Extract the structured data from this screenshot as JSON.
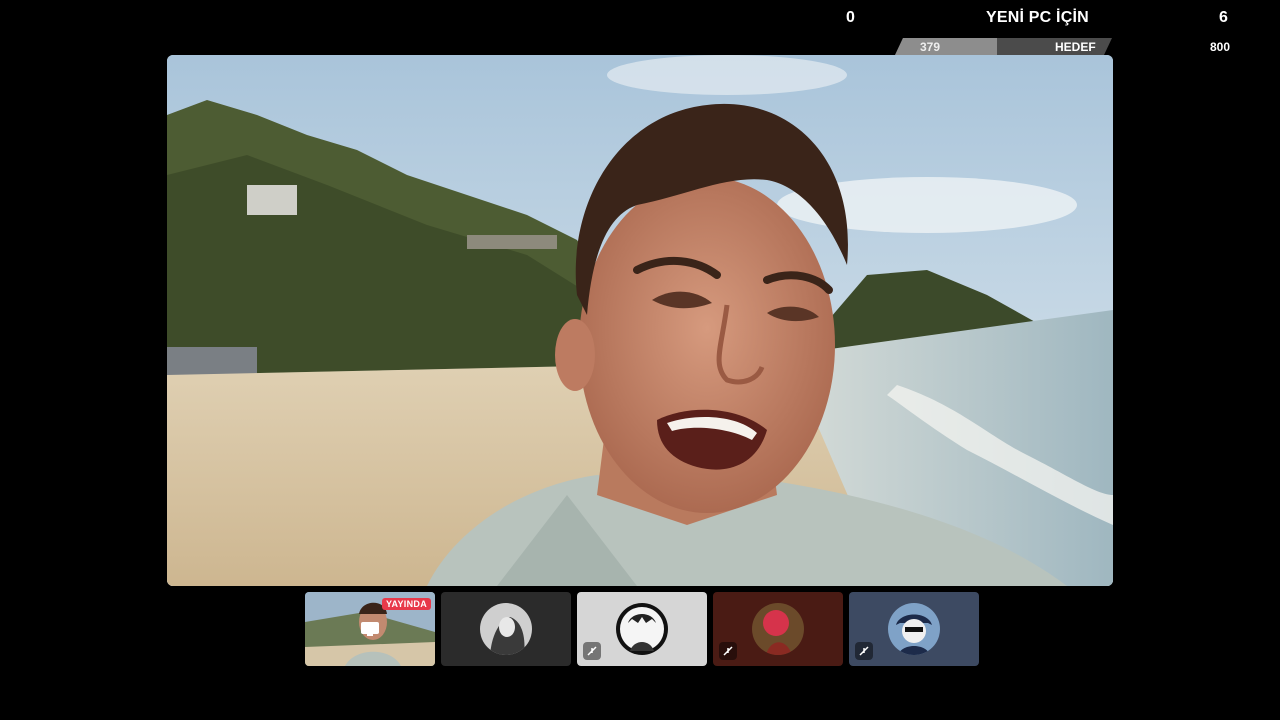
{
  "goal": {
    "left_count": "0",
    "title": "YENİ PC İÇİN",
    "right_count": "6",
    "current": "379",
    "label": "HEDEF",
    "target": "800",
    "progress_fraction": 0.47
  },
  "main_video": {
    "subject": "beach selfie video",
    "colors": {
      "sky": "#c6d9e8",
      "sand": "#d9c6a5",
      "sea": "#bcc9cc",
      "trees": "#4d5b35"
    }
  },
  "participants": [
    {
      "badge": "YAYINDA",
      "icon": "screen-share-icon",
      "muted": false
    },
    {
      "icon": "avatar-icon",
      "muted": false
    },
    {
      "icon": "avatar-icon",
      "muted": true
    },
    {
      "icon": "avatar-icon",
      "muted": true
    },
    {
      "icon": "avatar-icon",
      "muted": true
    }
  ]
}
